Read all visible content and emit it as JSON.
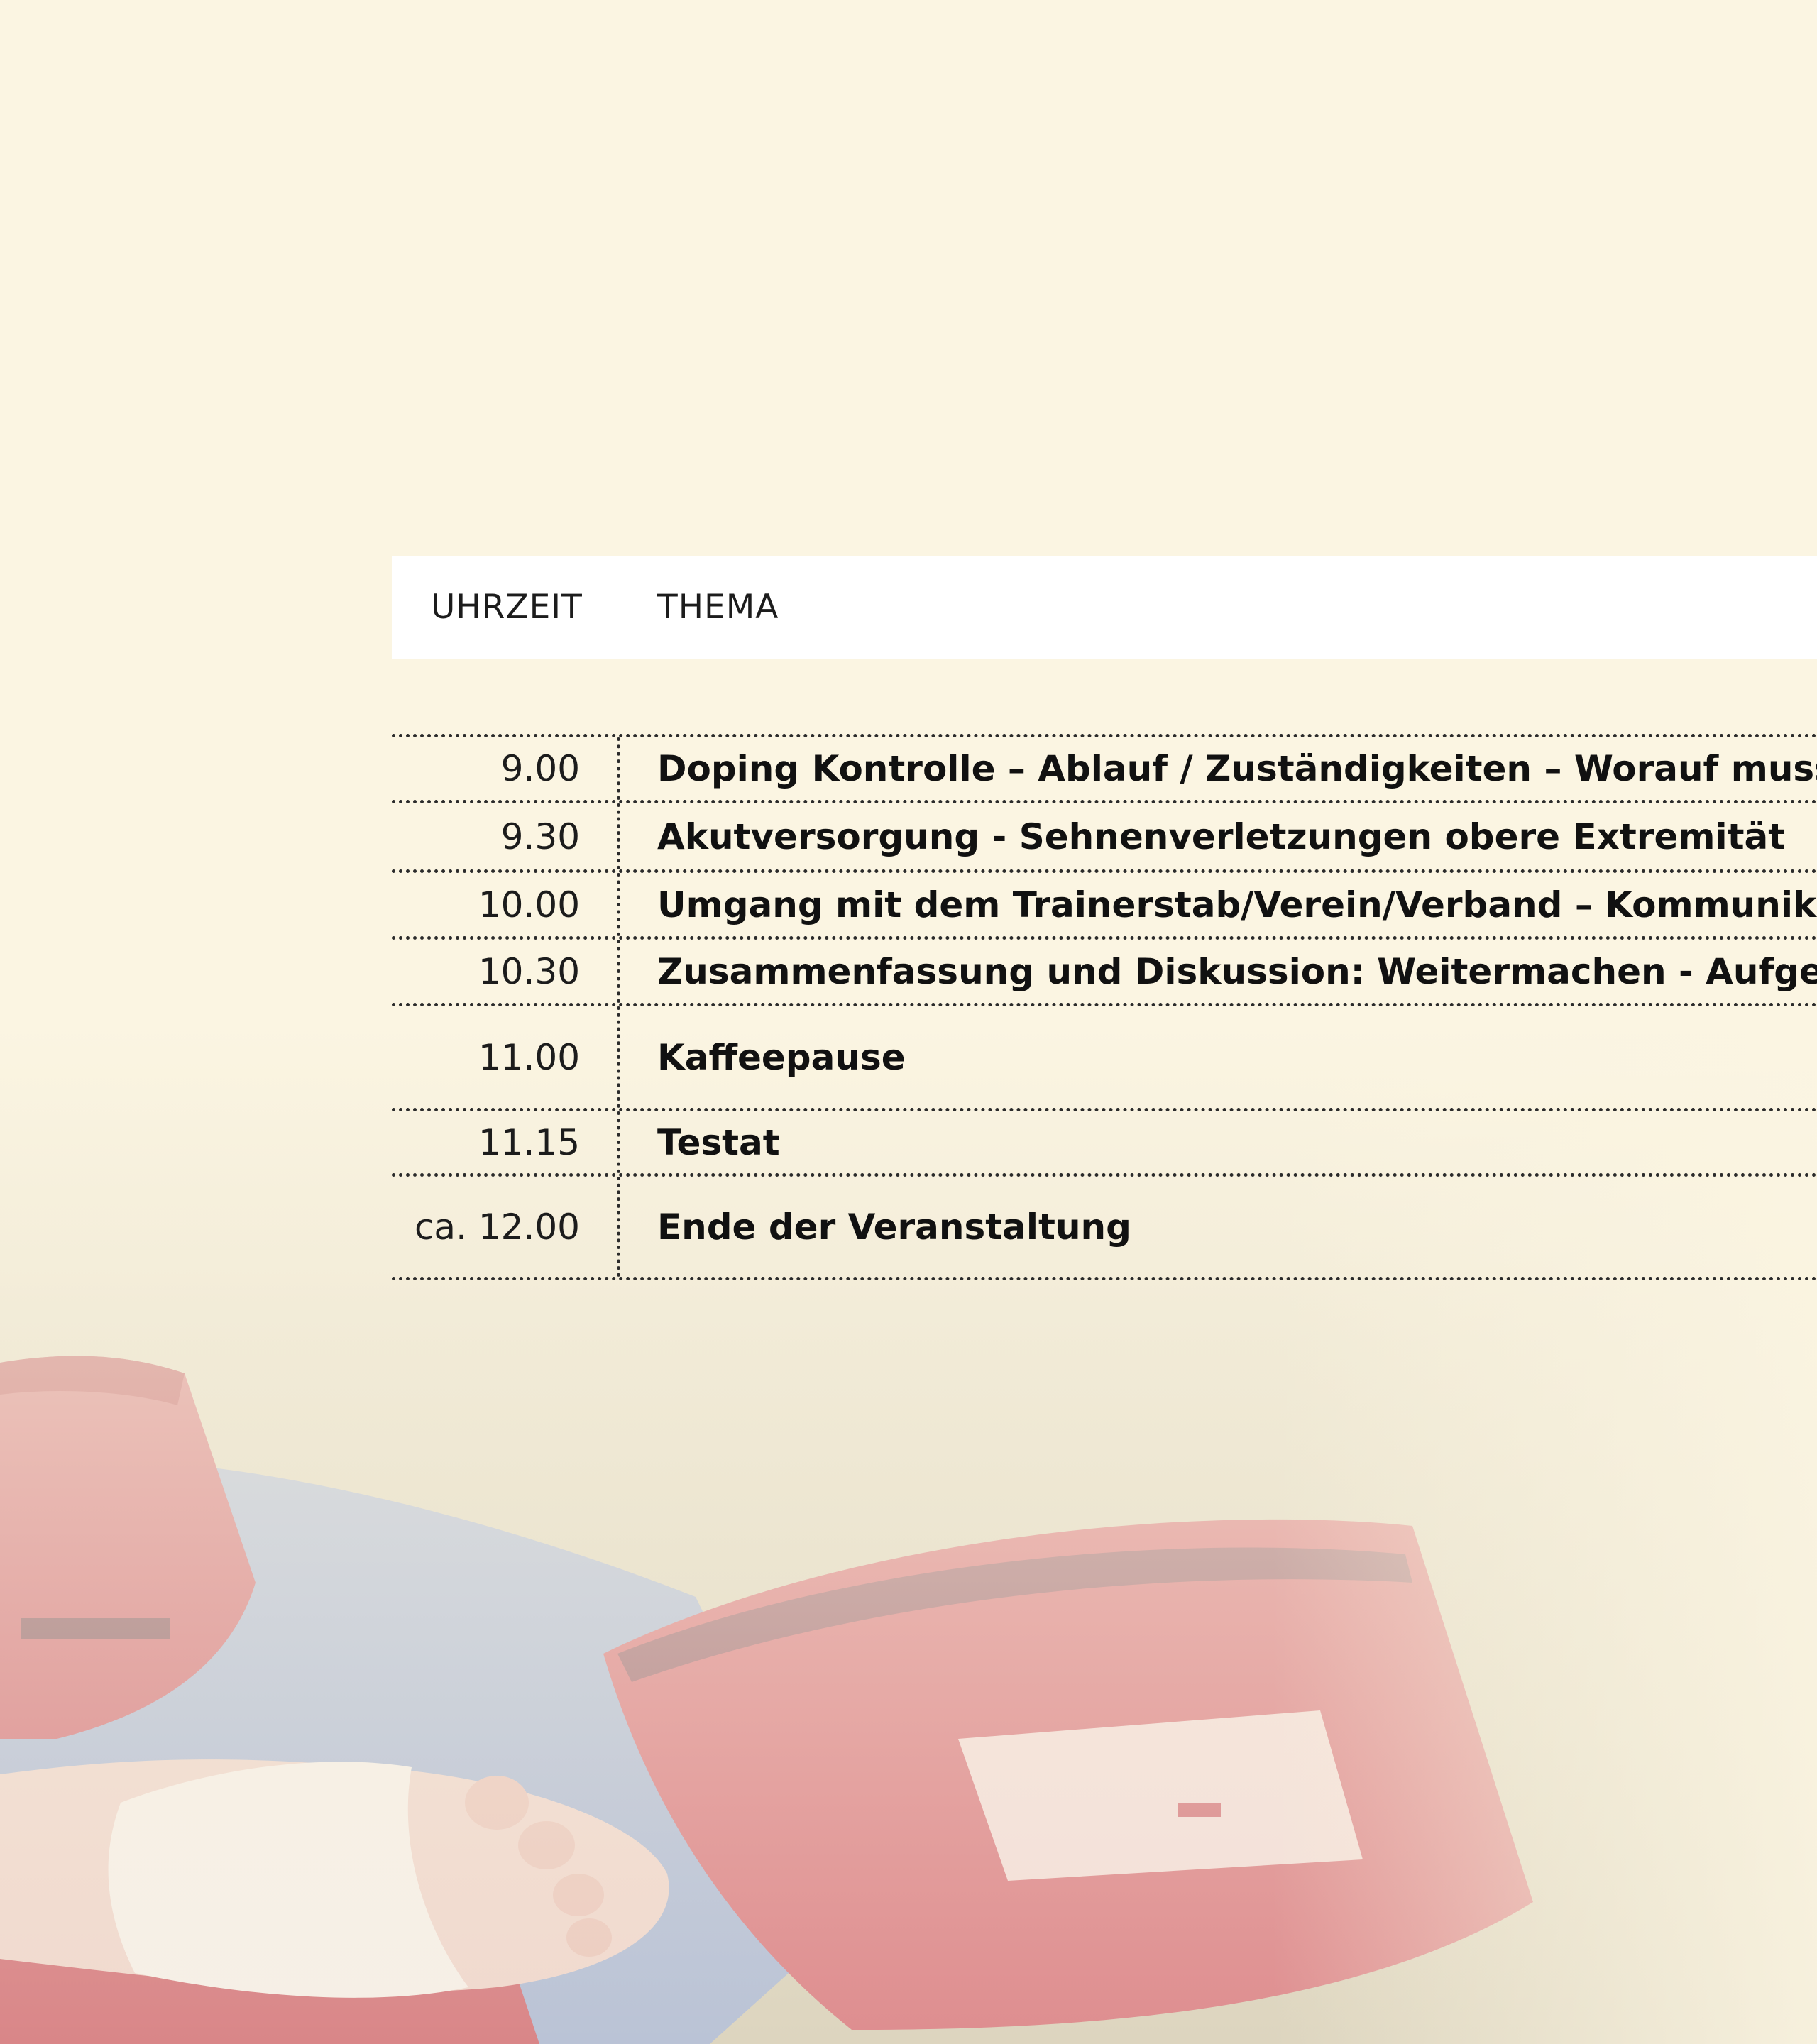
{
  "table": {
    "header": {
      "time_label": "UHRZEIT",
      "topic_label": "THEMA"
    },
    "rows": [
      {
        "time": "9.00",
        "topic": "Doping Kontrolle – Ablauf / Zuständigkeiten – Worauf muss ich ach"
      },
      {
        "time": "9.30",
        "topic": "Akutversorgung - Sehnenverletzungen obere Extremität"
      },
      {
        "time": "10.00",
        "topic": "Umgang mit dem Trainerstab/Verein/Verband – Kommunikation At"
      },
      {
        "time": "10.30",
        "topic": "Zusammenfassung und Diskussion: Weitermachen - Aufgeben"
      },
      {
        "time": "11.00",
        "topic": "Kaffeepause"
      },
      {
        "time": "11.15",
        "topic": "Testat"
      },
      {
        "time": "ca. 12.00",
        "topic": "Ende der Veranstaltung"
      }
    ]
  },
  "colors": {
    "background": "#fbf5e2",
    "header_bar": "#ffffff",
    "text": "#111111",
    "divider": "#2b2b2b"
  }
}
